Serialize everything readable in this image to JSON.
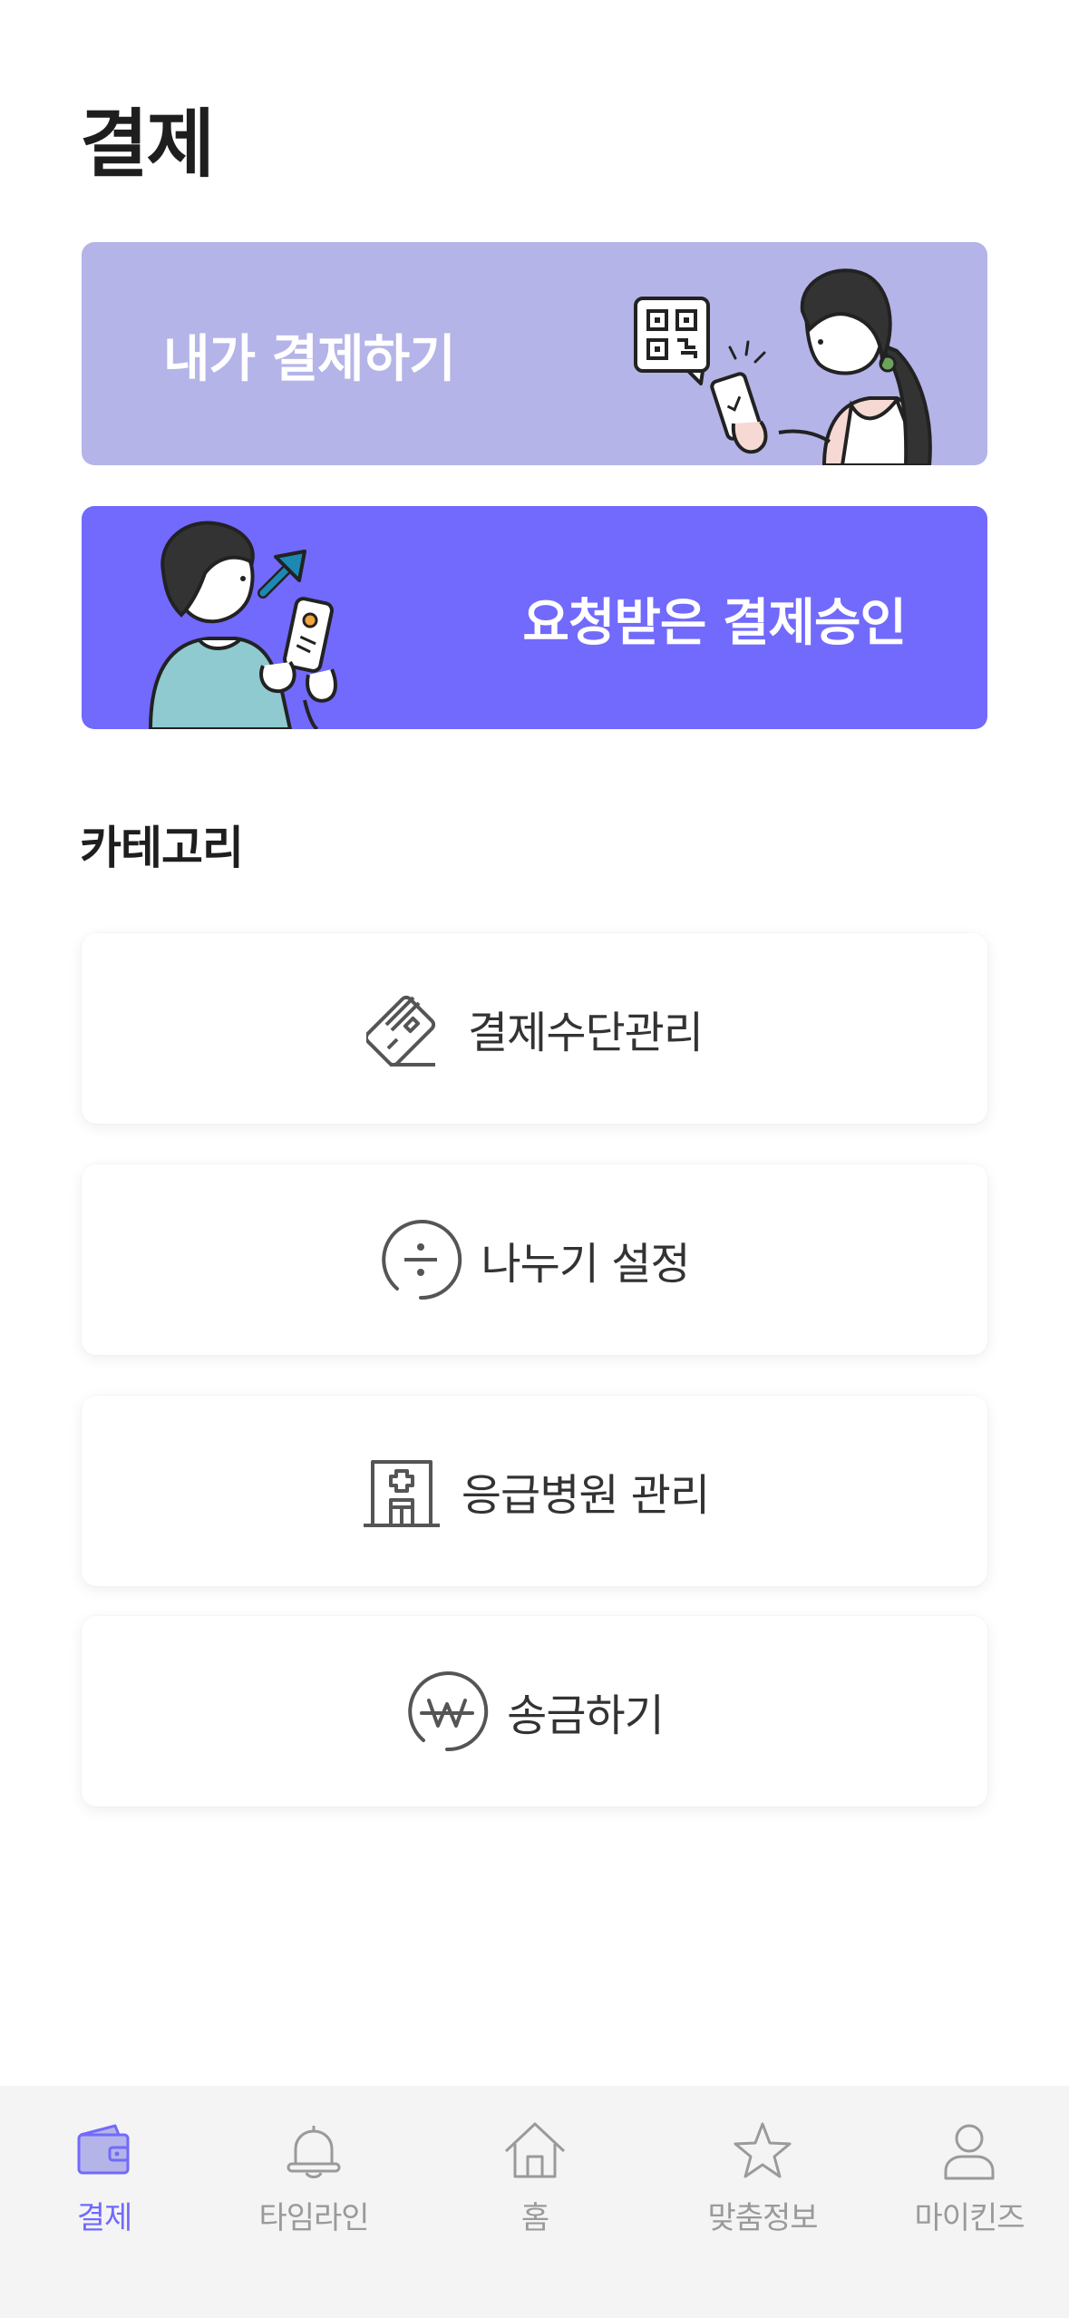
{
  "header": {
    "title": "결제"
  },
  "banners": {
    "self_pay": {
      "label": "내가 결제하기"
    },
    "requested": {
      "label": "요청받은 결제승인"
    }
  },
  "category": {
    "title": "카테고리",
    "items": [
      {
        "label": "결제수단관리",
        "icon": "credit-card-icon"
      },
      {
        "label": "나누기 설정",
        "icon": "divide-icon"
      },
      {
        "label": "응급병원 관리",
        "icon": "hospital-icon"
      },
      {
        "label": "송금하기",
        "icon": "won-icon"
      }
    ]
  },
  "nav": {
    "active_color": "#716afc",
    "inactive_color": "#9a9a9a",
    "items": [
      {
        "label": "결제",
        "icon": "wallet-icon",
        "active": true
      },
      {
        "label": "타임라인",
        "icon": "bell-icon",
        "active": false
      },
      {
        "label": "홈",
        "icon": "home-icon",
        "active": false
      },
      {
        "label": "맞춤정보",
        "icon": "star-icon",
        "active": false
      },
      {
        "label": "마이킨즈",
        "icon": "person-icon",
        "active": false
      }
    ]
  },
  "colors": {
    "banner_self_bg": "#b4b4e9",
    "banner_request_bg": "#716afc",
    "accent": "#716afc"
  }
}
